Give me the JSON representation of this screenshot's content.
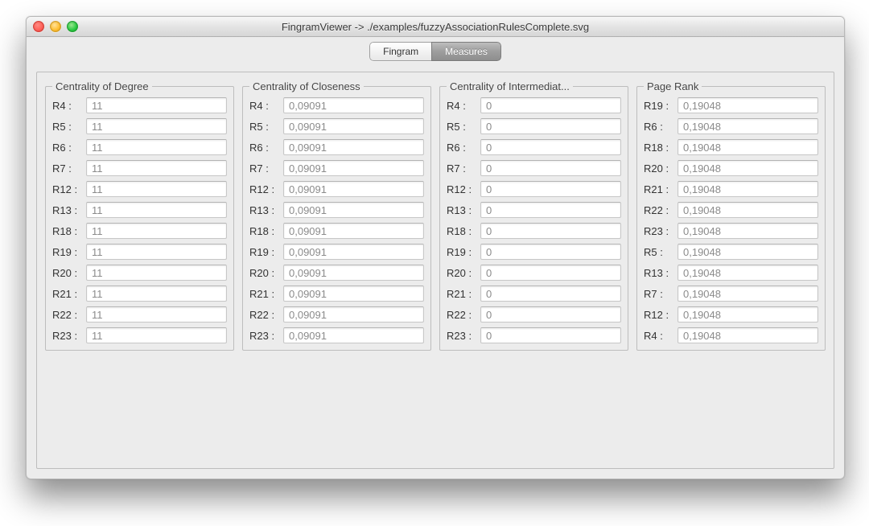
{
  "window": {
    "title": "FingramViewer -> ./examples/fuzzyAssociationRulesComplete.svg"
  },
  "tabs": {
    "fingram": "Fingram",
    "measures": "Measures"
  },
  "groups": [
    {
      "id": "degree",
      "title": "Centrality of Degree",
      "rows": [
        {
          "label": "R4 :",
          "value": "11"
        },
        {
          "label": "R5 :",
          "value": "11"
        },
        {
          "label": "R6 :",
          "value": "11"
        },
        {
          "label": "R7 :",
          "value": "11"
        },
        {
          "label": "R12 :",
          "value": "11"
        },
        {
          "label": "R13 :",
          "value": "11"
        },
        {
          "label": "R18 :",
          "value": "11"
        },
        {
          "label": "R19 :",
          "value": "11"
        },
        {
          "label": "R20 :",
          "value": "11"
        },
        {
          "label": "R21 :",
          "value": "11"
        },
        {
          "label": "R22 :",
          "value": "11"
        },
        {
          "label": "R23 :",
          "value": "11"
        }
      ]
    },
    {
      "id": "closeness",
      "title": "Centrality of Closeness",
      "rows": [
        {
          "label": "R4 :",
          "value": "0,09091"
        },
        {
          "label": "R5 :",
          "value": "0,09091"
        },
        {
          "label": "R6 :",
          "value": "0,09091"
        },
        {
          "label": "R7 :",
          "value": "0,09091"
        },
        {
          "label": "R12 :",
          "value": "0,09091"
        },
        {
          "label": "R13 :",
          "value": "0,09091"
        },
        {
          "label": "R18 :",
          "value": "0,09091"
        },
        {
          "label": "R19 :",
          "value": "0,09091"
        },
        {
          "label": "R20 :",
          "value": "0,09091"
        },
        {
          "label": "R21 :",
          "value": "0,09091"
        },
        {
          "label": "R22 :",
          "value": "0,09091"
        },
        {
          "label": "R23 :",
          "value": "0,09091"
        }
      ]
    },
    {
      "id": "intermediation",
      "title": "Centrality of Intermediat...",
      "rows": [
        {
          "label": "R4 :",
          "value": "0"
        },
        {
          "label": "R5 :",
          "value": "0"
        },
        {
          "label": "R6 :",
          "value": "0"
        },
        {
          "label": "R7 :",
          "value": "0"
        },
        {
          "label": "R12 :",
          "value": "0"
        },
        {
          "label": "R13 :",
          "value": "0"
        },
        {
          "label": "R18 :",
          "value": "0"
        },
        {
          "label": "R19 :",
          "value": "0"
        },
        {
          "label": "R20 :",
          "value": "0"
        },
        {
          "label": "R21 :",
          "value": "0"
        },
        {
          "label": "R22 :",
          "value": "0"
        },
        {
          "label": "R23 :",
          "value": "0"
        }
      ]
    },
    {
      "id": "pagerank",
      "title": "Page Rank",
      "rows": [
        {
          "label": "R19 :",
          "value": "0,19048"
        },
        {
          "label": "R6 :",
          "value": "0,19048"
        },
        {
          "label": "R18 :",
          "value": "0,19048"
        },
        {
          "label": "R20 :",
          "value": "0,19048"
        },
        {
          "label": "R21 :",
          "value": "0,19048"
        },
        {
          "label": "R22 :",
          "value": "0,19048"
        },
        {
          "label": "R23 :",
          "value": "0,19048"
        },
        {
          "label": "R5 :",
          "value": "0,19048"
        },
        {
          "label": "R13 :",
          "value": "0,19048"
        },
        {
          "label": "R7 :",
          "value": "0,19048"
        },
        {
          "label": "R12 :",
          "value": "0,19048"
        },
        {
          "label": "R4 :",
          "value": "0,19048"
        }
      ]
    }
  ]
}
